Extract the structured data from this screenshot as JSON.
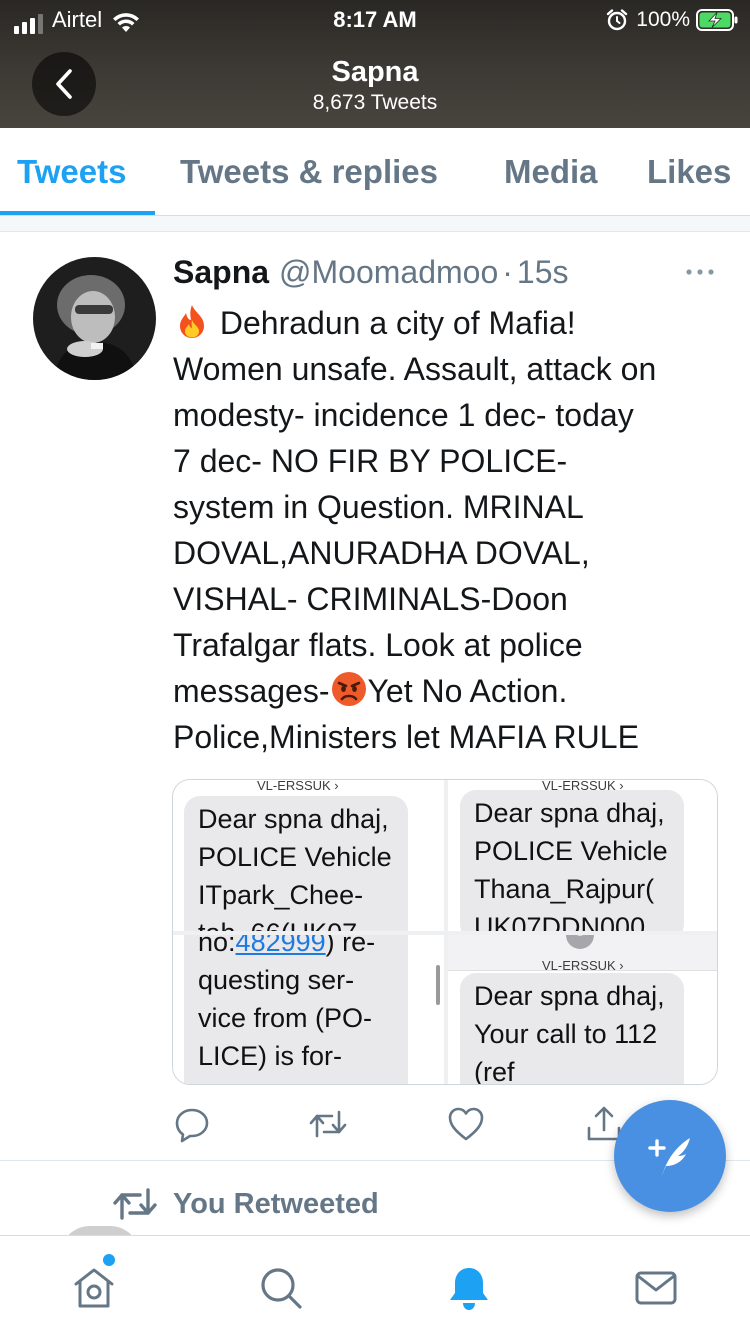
{
  "status_bar": {
    "carrier": "Airtel",
    "time": "8:17 AM",
    "battery": "100%"
  },
  "header": {
    "title": "Sapna",
    "subtitle": "8,673 Tweets",
    "back_icon": "chevron-left-icon"
  },
  "tabs": [
    {
      "label": "Tweets",
      "active": true
    },
    {
      "label": "Tweets & replies",
      "active": false
    },
    {
      "label": "Media",
      "active": false
    },
    {
      "label": "Likes",
      "active": false
    }
  ],
  "tweet": {
    "name": "Sapna",
    "handle": "@Moomadmoo",
    "separator": "·",
    "time": "15s",
    "lines": [
      "Dehradun a city of Mafia!",
      "Women unsafe. Assault, attack on",
      "modesty- incidence 1 dec- today",
      "7 dec- NO FIR BY POLICE-",
      "system in Question. MRINAL",
      "DOVAL,ANURADHA DOVAL,",
      "VISHAL- CRIMINALS-Doon",
      "Trafalgar flats. Look at police",
      "messages-",
      "Police,Ministers let MAFIA RULE"
    ],
    "line9_tail": "Yet No Action.",
    "emoji_names": [
      "fire-emoji",
      "angry-face-emoji"
    ]
  },
  "media": {
    "sender": "VL-ERSSUK ›",
    "shot1": {
      "lines": [
        "Dear spna dhaj,",
        "POLICE Vehicle",
        "ITpark_Chee-",
        "tah_66(UK07"
      ]
    },
    "shot2": {
      "lines": [
        "Dear spna dhaj,",
        "POLICE Vehicle",
        "Thana_Rajpur(",
        "UK07DDN000"
      ]
    },
    "shot3": {
      "line1_prefix": "no:",
      "line1_link": "482999",
      "line1_suffix": ") re-",
      "lines": [
        "questing ser-",
        "vice from (PO-",
        "LICE) is for-"
      ]
    },
    "shot4": {
      "lines": [
        "Dear spna dhaj,",
        "Your call to 112",
        "(ref"
      ]
    }
  },
  "actions": [
    "reply-icon",
    "retweet-icon",
    "like-icon",
    "share-icon"
  ],
  "retweet_row": {
    "label": "You Retweeted"
  },
  "fab": {
    "icon": "compose-tweet-icon"
  },
  "bottom_nav": [
    "home-icon",
    "search-icon",
    "notifications-icon",
    "messages-icon"
  ],
  "colors": {
    "accent": "#1da1f2",
    "fab": "#4a90e2",
    "secondary_text": "#657786",
    "header_bg": "#3d3a35"
  }
}
